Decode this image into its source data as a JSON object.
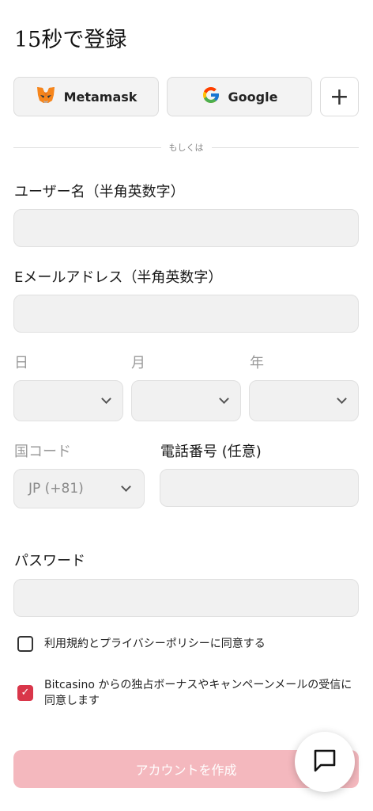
{
  "page": {
    "title": "15秒で登録"
  },
  "social": {
    "metamask_label": "Metamask",
    "google_label": "Google",
    "more_label": "+"
  },
  "divider": {
    "text": "もしくは"
  },
  "username": {
    "label": "ユーザー名（半角英数字）",
    "value": ""
  },
  "email": {
    "label": "Eメールアドレス（半角英数字）",
    "value": ""
  },
  "birthdate": {
    "day_label": "日",
    "month_label": "月",
    "year_label": "年"
  },
  "phone": {
    "country_label": "国コード",
    "country_value": "JP (+81)",
    "number_label": "電話番号 (任意)",
    "number_value": ""
  },
  "password": {
    "label": "パスワード",
    "value": ""
  },
  "consents": [
    {
      "text": "利用規約とプライバシーポリシーに同意する",
      "checked": false
    },
    {
      "text": "Bitcasino からの独占ボーナスやキャンペーンメールの受信に同意します",
      "checked": true
    }
  ],
  "submit": {
    "label": "アカウントを作成"
  },
  "icons": {
    "metamask": "metamask-fox-icon",
    "google": "google-g-icon",
    "plus": "plus-icon",
    "chevron": "chevron-down-icon",
    "chat": "chat-bubble-icon",
    "check": "checkmark-icon"
  },
  "colors": {
    "accent": "#d9364a",
    "submit_disabled": "#f4b8be",
    "field_bg": "#f1f1f1"
  }
}
